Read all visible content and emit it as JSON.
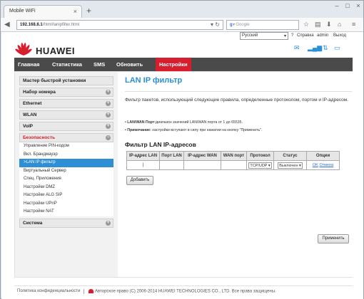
{
  "browser": {
    "tab_title": "Mobile WiFi",
    "url_host": "192.168.8.1",
    "url_path": "/html/lanipfilter.html",
    "search_placeholder": "Google"
  },
  "topbar": {
    "language": "Русский",
    "help": "Справка",
    "user": "admin",
    "logout": "Выход"
  },
  "brand": "HUAWEI",
  "nav": [
    "Главная",
    "Статистика",
    "SMS",
    "Обновить",
    "Настройки"
  ],
  "sidebar": {
    "items": [
      {
        "label": "Мастер быстрой установки"
      },
      {
        "label": "Набор номера"
      },
      {
        "label": "Ethernet"
      },
      {
        "label": "WLAN"
      },
      {
        "label": "VoIP"
      },
      {
        "label": "Безопасность"
      }
    ],
    "sub": [
      "Управление PIN-кодом",
      "Вкл. Брандмауэр",
      ">LAN IP фильтр",
      "Виртуальный Сервер",
      "Спец. Приложения",
      "Настройки DMZ",
      "Настройки ALG SIP",
      "Настройки UPnP",
      "Настройки NAT"
    ],
    "last": "Система"
  },
  "main": {
    "title": "LAN IP фильтр",
    "description": "Фильтр пакетов, использующий следующие правила, определенные протоколом, портом и IP-адресом.",
    "bullet1_label": "LAN/WAN Порт:",
    "bullet1_text": "диапазон значений LAN/WAN порта от 1 до 65535.",
    "bullet2_label": "Примечание:",
    "bullet2_text": "настройки вступают в силу при нажатии на кнопку \"Применить\".",
    "list_title": "Фильтр LAN IP-адресов",
    "columns": [
      "IP-адрес LAN",
      "Порт LAN",
      "IP-адрес WAN",
      "WAN порт",
      "Протокол",
      "Статус",
      "Опции"
    ],
    "row": {
      "protocol": "TCP/UDP",
      "status": "Выключен",
      "ok": "OK",
      "cancel": "Отмена"
    },
    "add_button": "Добавить",
    "apply_button": "Применить"
  },
  "footer": {
    "privacy": "Политика конфиденциальности",
    "copyright": "Авторское право (C) 2006-2014 HUAWEI TECHNOLOGIES CO., LTD. Все права защищены."
  }
}
